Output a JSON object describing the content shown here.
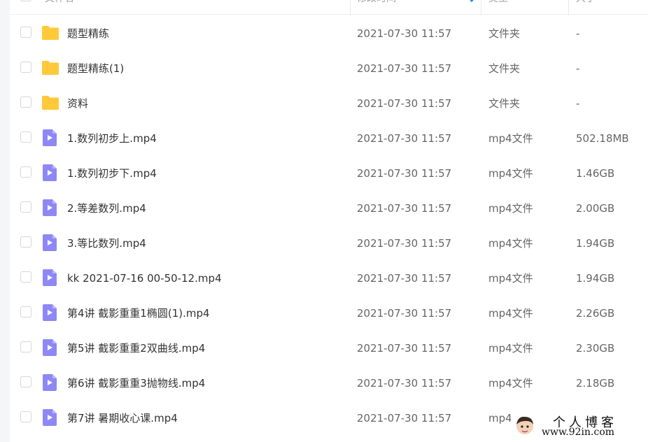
{
  "header": {
    "name": "文件名",
    "modified": "修改时间",
    "type": "类型",
    "size": "大小"
  },
  "colors": {
    "folder": "#FFC93B",
    "video_icon": "#8E88F6",
    "header_text": "#9aa0a8"
  },
  "files": [
    {
      "icon": "folder-icon",
      "name": "题型精练",
      "time": "2021-07-30 11:57",
      "type": "文件夹",
      "size": "-"
    },
    {
      "icon": "folder-icon",
      "name": "题型精练(1)",
      "time": "2021-07-30 11:57",
      "type": "文件夹",
      "size": "-"
    },
    {
      "icon": "folder-icon",
      "name": "资料",
      "time": "2021-07-30 11:57",
      "type": "文件夹",
      "size": "-"
    },
    {
      "icon": "video-file-icon",
      "name": "1.数列初步上.mp4",
      "time": "2021-07-30 11:57",
      "type": "mp4文件",
      "size": "502.18MB"
    },
    {
      "icon": "video-file-icon",
      "name": "1.数列初步下.mp4",
      "time": "2021-07-30 11:57",
      "type": "mp4文件",
      "size": "1.46GB"
    },
    {
      "icon": "video-file-icon",
      "name": "2.等差数列.mp4",
      "time": "2021-07-30 11:57",
      "type": "mp4文件",
      "size": "2.00GB"
    },
    {
      "icon": "video-file-icon",
      "name": "3.等比数列.mp4",
      "time": "2021-07-30 11:57",
      "type": "mp4文件",
      "size": "1.94GB"
    },
    {
      "icon": "video-file-icon",
      "name": "kk 2021-07-16 00-50-12.mp4",
      "time": "2021-07-30 11:57",
      "type": "mp4文件",
      "size": "1.94GB"
    },
    {
      "icon": "video-file-icon",
      "name": "第4讲 截影重重1椭圆(1).mp4",
      "time": "2021-07-30 11:57",
      "type": "mp4文件",
      "size": "2.26GB"
    },
    {
      "icon": "video-file-icon",
      "name": "第5讲 截影重重2双曲线.mp4",
      "time": "2021-07-30 11:57",
      "type": "mp4文件",
      "size": "2.30GB"
    },
    {
      "icon": "video-file-icon",
      "name": "第6讲 截影重重3抛物线.mp4",
      "time": "2021-07-30 11:57",
      "type": "mp4文件",
      "size": "2.18GB"
    },
    {
      "icon": "video-file-icon",
      "name": "第7讲 暑期收心课.mp4",
      "time": "2021-07-30 11:57",
      "type": "mp4",
      "size": ""
    }
  ],
  "watermark": {
    "title": "个人博客",
    "url": "www.92in.com"
  }
}
